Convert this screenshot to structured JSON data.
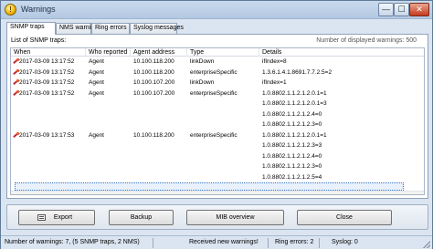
{
  "window": {
    "title": "Warnings",
    "icon": "warning-icon",
    "min": "—",
    "max": "☐",
    "close": "✕"
  },
  "tabs": [
    "SNMP traps",
    "NMS warnings",
    "Ring errors",
    "Syslog messages"
  ],
  "panel": {
    "list_label": "List of SNMP traps:",
    "count_label": "Number of displayed warnings: 500"
  },
  "table": {
    "columns": [
      "When",
      "Who reported",
      "Agent address",
      "Type",
      "Details"
    ],
    "rows": [
      {
        "when": "2017-03-09 13:17:52",
        "who": "Agent",
        "addr": "10.100.118.200",
        "type": "linkDown",
        "details": "ifIndex=8"
      },
      {
        "when": "2017-03-09 13:17:52",
        "who": "Agent",
        "addr": "10.100.118.200",
        "type": "enterpriseSpecific",
        "details": "1.3.6.1.4.1.8691.7.7.2.5=2"
      },
      {
        "when": "2017-03-09 13:17:52",
        "who": "Agent",
        "addr": "10.100.107.200",
        "type": "linkDown",
        "details": "ifIndex=1"
      },
      {
        "when": "2017-03-09 13:17:52",
        "who": "Agent",
        "addr": "10.100.107.200",
        "type": "enterpriseSpecific",
        "details": "1.0.8802.1.1.2.1.2.0.1=1"
      },
      {
        "when": "",
        "who": "",
        "addr": "",
        "type": "",
        "details": "1.0.8802.1.1.2.1.2.0.1=3"
      },
      {
        "when": "",
        "who": "",
        "addr": "",
        "type": "",
        "details": "1.0.8802.1.1.2.1.2.4=0"
      },
      {
        "when": "",
        "who": "",
        "addr": "",
        "type": "",
        "details": "1.0.8802.1.1.2.1.2.3=0"
      },
      {
        "when": "2017-03-09 13:17:53",
        "who": "Agent",
        "addr": "10.100.118.200",
        "type": "enterpriseSpecific",
        "details": "1.0.8802.1.1.2.1.2.0.1=1"
      },
      {
        "when": "",
        "who": "",
        "addr": "",
        "type": "",
        "details": "1.0.8802.1.1.2.1.2.3=3"
      },
      {
        "when": "",
        "who": "",
        "addr": "",
        "type": "",
        "details": "1.0.8802.1.1.2.1.2.4=0"
      },
      {
        "when": "",
        "who": "",
        "addr": "",
        "type": "",
        "details": "1.0.8802.1.1.2.1.2.3=0"
      },
      {
        "when": "",
        "who": "",
        "addr": "",
        "type": "",
        "details": "1.0.8802.1.1.2.1.2.5=4"
      }
    ]
  },
  "buttons": {
    "export": "Export",
    "backup": "Backup",
    "mib": "MIB overview",
    "close": "Close"
  },
  "status": {
    "warnings": "Number of warnings: 7, (5 SNMP traps, 2 NMS)",
    "received": "Received new warnings!",
    "ring": "Ring errors: 2",
    "syslog": "Syslog: 0"
  }
}
